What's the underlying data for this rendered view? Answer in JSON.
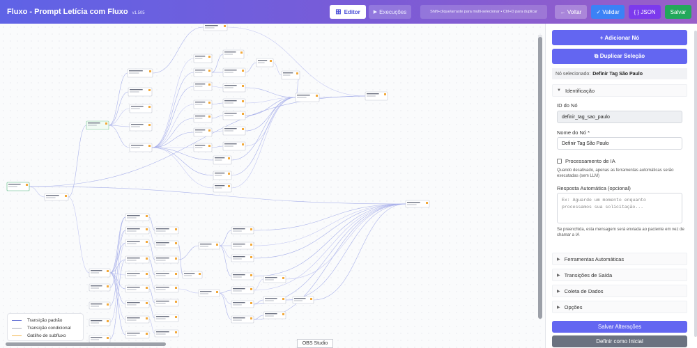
{
  "header": {
    "title": "Fluxo - Prompt Letícia com Fluxo",
    "version": "v1.505",
    "tab_editor": "Editor",
    "tab_execucoes": "Execuções",
    "hint": "Shift+clique/arraste para multi-selecionar • Ctrl+D para duplicar",
    "btn_voltar": "← Voltar",
    "btn_validar": "✓ Validar",
    "btn_json": "{ } JSON",
    "btn_salvar": "Salvar"
  },
  "legend": {
    "items": [
      {
        "label": "Transição padrão",
        "color": "#6f7bd8"
      },
      {
        "label": "Transição condicional",
        "color": "#a6aab5"
      },
      {
        "label": "Gatilho de subfluxo",
        "color": "#f2b54a"
      }
    ]
  },
  "taskbar": {
    "label": "OBS Studio"
  },
  "panel": {
    "btn_add": "+ Adicionar Nó",
    "btn_dup": "⧉ Duplicar Seleção",
    "selected_prefix": "Nó selecionado:",
    "selected_name": "Definir Tag São Paulo",
    "section_identificacao": "Identificação",
    "id_label": "ID do Nó",
    "id_value": "definir_tag_sao_paulo",
    "name_label": "Nome do Nó *",
    "name_value": "Definir Tag São Paulo",
    "ia_label": "Processamento de IA",
    "ia_help": "Quando desativado, apenas as ferramentas automáticas serão executadas (sem LLM)",
    "resp_label": "Resposta Automática (opcional)",
    "resp_placeholder": "Ex: Aguarde um momento enquanto processamos sua solicitação...",
    "resp_help": "Se preenchida, esta mensagem será enviada ao paciente em vez de chamar a IA",
    "sections": [
      "Ferramentas Automáticas",
      "Transições de Saída",
      "Coleta de Dados",
      "Opções"
    ],
    "btn_save": "Salvar Alterações",
    "btn_initial": "Definir como Inicial"
  },
  "colors": {
    "header_start": "#5f63e6",
    "accent": "#6366f1",
    "save_green": "#22a85b",
    "validate_blue": "#3b82f6",
    "json_purple": "#7c3aed"
  }
}
